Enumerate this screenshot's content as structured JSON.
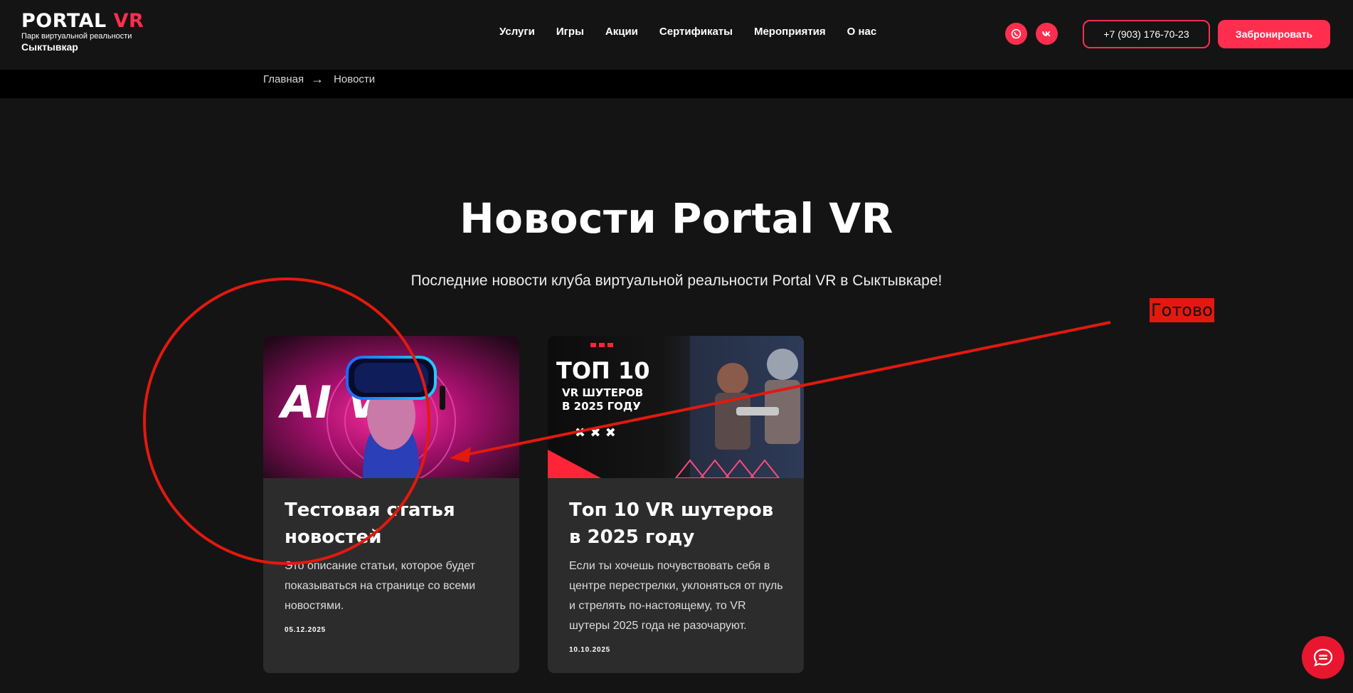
{
  "header": {
    "logo": {
      "name_main": "PORTAL",
      "name_accent": "VR",
      "tagline": "Парк виртуальной реальности",
      "city": "Сыктывкар"
    },
    "nav": [
      {
        "label": "Услуги"
      },
      {
        "label": "Игры"
      },
      {
        "label": "Акции"
      },
      {
        "label": "Сертификаты"
      },
      {
        "label": "Мероприятия"
      },
      {
        "label": "О нас"
      }
    ],
    "social": [
      {
        "icon": "whatsapp-icon"
      },
      {
        "icon": "vk-icon"
      }
    ],
    "phone": "+7 (903) 176-70-23",
    "book_label": "Забронировать"
  },
  "breadcrumb": {
    "home": "Главная",
    "separator": "→",
    "current": "Новости"
  },
  "page": {
    "title": "Новости Portal VR",
    "subtitle": "Последние новости клуба виртуальной реальности Portal VR в Сыктывкаре!"
  },
  "news": [
    {
      "image_text": "AI VR",
      "title": "Тестовая статья новостей",
      "description": "Это описание статьи, которое будет показываться на странице со всеми новостями.",
      "date": "05.12.2025"
    },
    {
      "image_text_big": "ТОП 10",
      "image_text_small_1": "VR ШУТЕРОВ",
      "image_text_small_2": "В 2025 ГОДУ",
      "title": "Топ 10 VR шутеров в 2025 году",
      "description": "Если ты хочешь почувствовать себя в центре перестрелки, уклоняться от пуль и стрелять по-настоящему, то VR шутеры 2025 года не разочаруют.",
      "date": "10.10.2025"
    }
  ],
  "annotation": {
    "label": "Готово",
    "color": "#e2190f"
  },
  "colors": {
    "accent": "#ff2e4e",
    "background": "#141414",
    "card": "#2c2c2c"
  },
  "chat": {
    "icon": "chat-bubble-icon"
  }
}
